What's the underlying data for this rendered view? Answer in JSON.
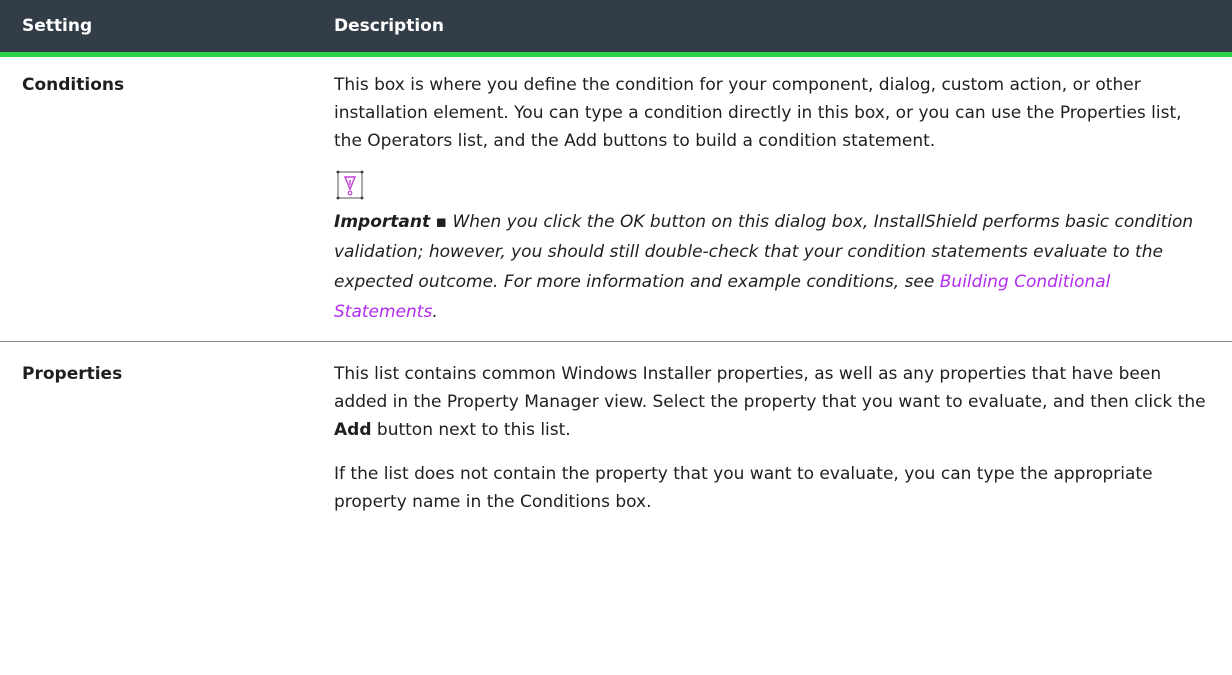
{
  "table": {
    "headers": {
      "setting": "Setting",
      "description": "Description"
    },
    "rows": [
      {
        "setting": "Conditions",
        "description": "This box is where you define the condition for your component, dialog, custom action, or other installation element. You can type a condition directly in this box, or you can use the Properties list, the Operators list, and the Add buttons to build a condition statement.",
        "note": {
          "icon": "important-note-icon",
          "label": "Important",
          "separator": " ▪ ",
          "text": "When you click the OK button on this dialog box, InstallShield performs basic condition validation; however, you should still double-check that your condition statements evaluate to the expected outcome. For more information and example conditions, see ",
          "link_text": "Building Conditional Statements",
          "text_after": "."
        }
      },
      {
        "setting": "Properties",
        "description_1_before": "This list contains common Windows Installer properties, as well as any properties that have been added in the Property Manager view. Select the property that you want to evaluate, and then click the ",
        "description_1_bold": "Add",
        "description_1_after": " button next to this list.",
        "description_2": "If the list does not contain the property that you want to evaluate, you can type the appropriate property name in the Conditions box."
      }
    ]
  },
  "colors": {
    "header_bg": "#333d47",
    "header_accent": "#2dd247",
    "link": "#b32bf0",
    "icon": "#c23fd6"
  }
}
